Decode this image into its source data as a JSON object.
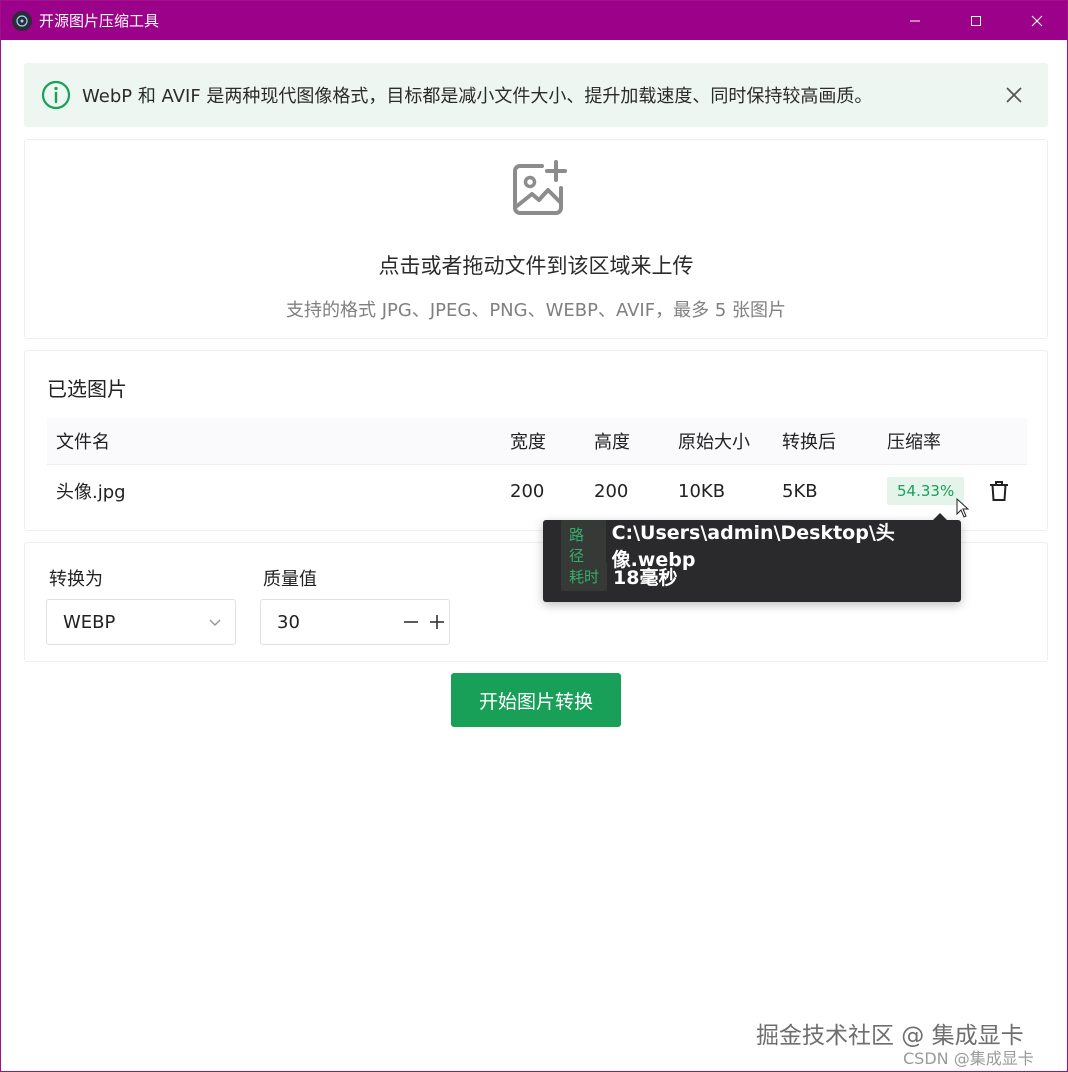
{
  "window": {
    "title": "开源图片压缩工具"
  },
  "alert": {
    "text": "WebP 和 AVIF 是两种现代图像格式，目标都是减小文件大小、提升加载速度、同时保持较高画质。",
    "icon": "info-icon",
    "color": "#18a058"
  },
  "upload": {
    "icon": "image-add-icon",
    "title": "点击或者拖动文件到该区域来上传",
    "subtitle": "支持的格式 JPG、JPEG、PNG、WEBP、AVIF，最多 5 张图片"
  },
  "files": {
    "section_title": "已选图片",
    "columns": [
      "文件名",
      "宽度",
      "高度",
      "原始大小",
      "转换后",
      "压缩率"
    ],
    "rows": [
      {
        "name": "头像.jpg",
        "width": "200",
        "height": "200",
        "original_size": "10KB",
        "converted_size": "5KB",
        "compression_rate": "54.33%"
      }
    ]
  },
  "tooltip": {
    "path_label": "路径",
    "path_value": "C:\\Users\\admin\\Desktop\\头像.webp",
    "time_label": "耗时",
    "time_value": "18毫秒"
  },
  "settings": {
    "format_label": "转换为",
    "format_value": "WEBP",
    "quality_label": "质量值",
    "quality_value": "30"
  },
  "actions": {
    "start_label": "开始图片转换"
  },
  "watermark": {
    "line1": "掘金技术社区 @ 集成显卡",
    "line2": "CSDN @集成显卡"
  },
  "colors": {
    "titlebar": "#9c0289",
    "accent": "#18a058",
    "alert_bg": "#edf6f0"
  }
}
